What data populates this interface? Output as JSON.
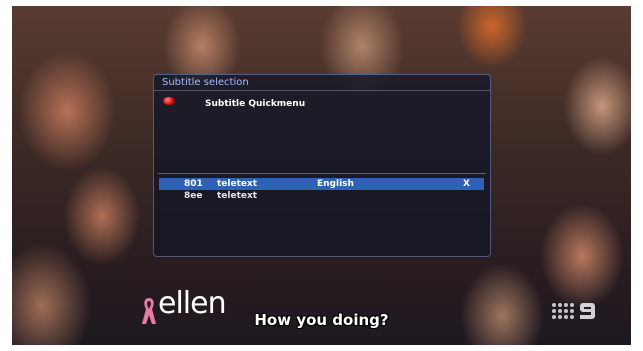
{
  "osd": {
    "title": "Subtitle selection",
    "quickmenu_label": "Subtitle Quickmenu",
    "red_key_icon": "red-button-icon",
    "rows": [
      {
        "number": "801",
        "type": "teletext",
        "language": "English",
        "selected_mark": "X",
        "selected": true
      },
      {
        "number": "8ee",
        "type": "teletext",
        "language": "",
        "selected_mark": "",
        "selected": false
      }
    ]
  },
  "video": {
    "logo_text": "ellen",
    "ribbon_icon": "pink-ribbon-icon",
    "channel_bug_icon": "channel-9-logo-icon",
    "subtitle_text": "How you doing?"
  },
  "colors": {
    "osd_title": "#9cc0ff",
    "selection_bar": "#2f62b4",
    "ribbon": "#e87aa8"
  }
}
